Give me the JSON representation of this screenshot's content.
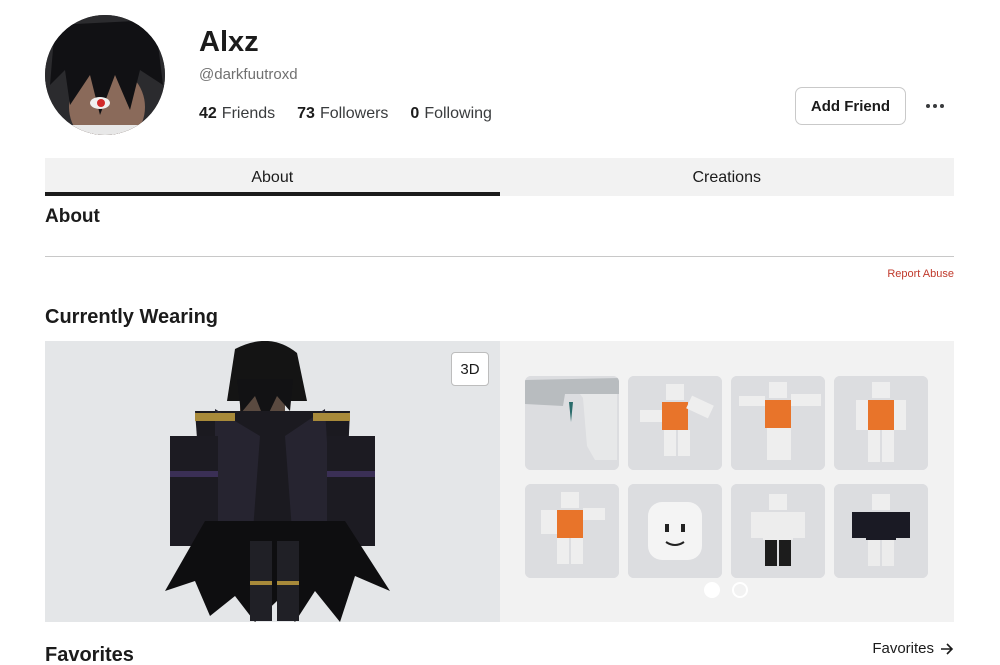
{
  "profile": {
    "display_name": "Alxz",
    "username": "@darkfuutroxd",
    "stats": [
      {
        "value": "42",
        "label": "Friends"
      },
      {
        "value": "73",
        "label": "Followers"
      },
      {
        "value": "0",
        "label": "Following"
      }
    ],
    "add_friend_label": "Add Friend",
    "more_icon": "more-horizontal-icon"
  },
  "tabs": [
    {
      "label": "About",
      "active": true
    },
    {
      "label": "Creations",
      "active": false
    }
  ],
  "about": {
    "title": "About",
    "report_label": "Report Abuse",
    "report_color": "#c0392b"
  },
  "wearing": {
    "title": "Currently Wearing",
    "view_toggle_label": "3D",
    "items": [
      {
        "name": "accessory-item"
      },
      {
        "name": "animation-item"
      },
      {
        "name": "animation-item"
      },
      {
        "name": "animation-item"
      },
      {
        "name": "animation-item"
      },
      {
        "name": "face-item"
      },
      {
        "name": "shirt-item"
      },
      {
        "name": "outfit-item"
      }
    ],
    "pages": 2,
    "current_page": 1
  },
  "favorites": {
    "title": "Favorites",
    "link_label": "Favorites",
    "link_icon": "arrow-right-icon"
  }
}
